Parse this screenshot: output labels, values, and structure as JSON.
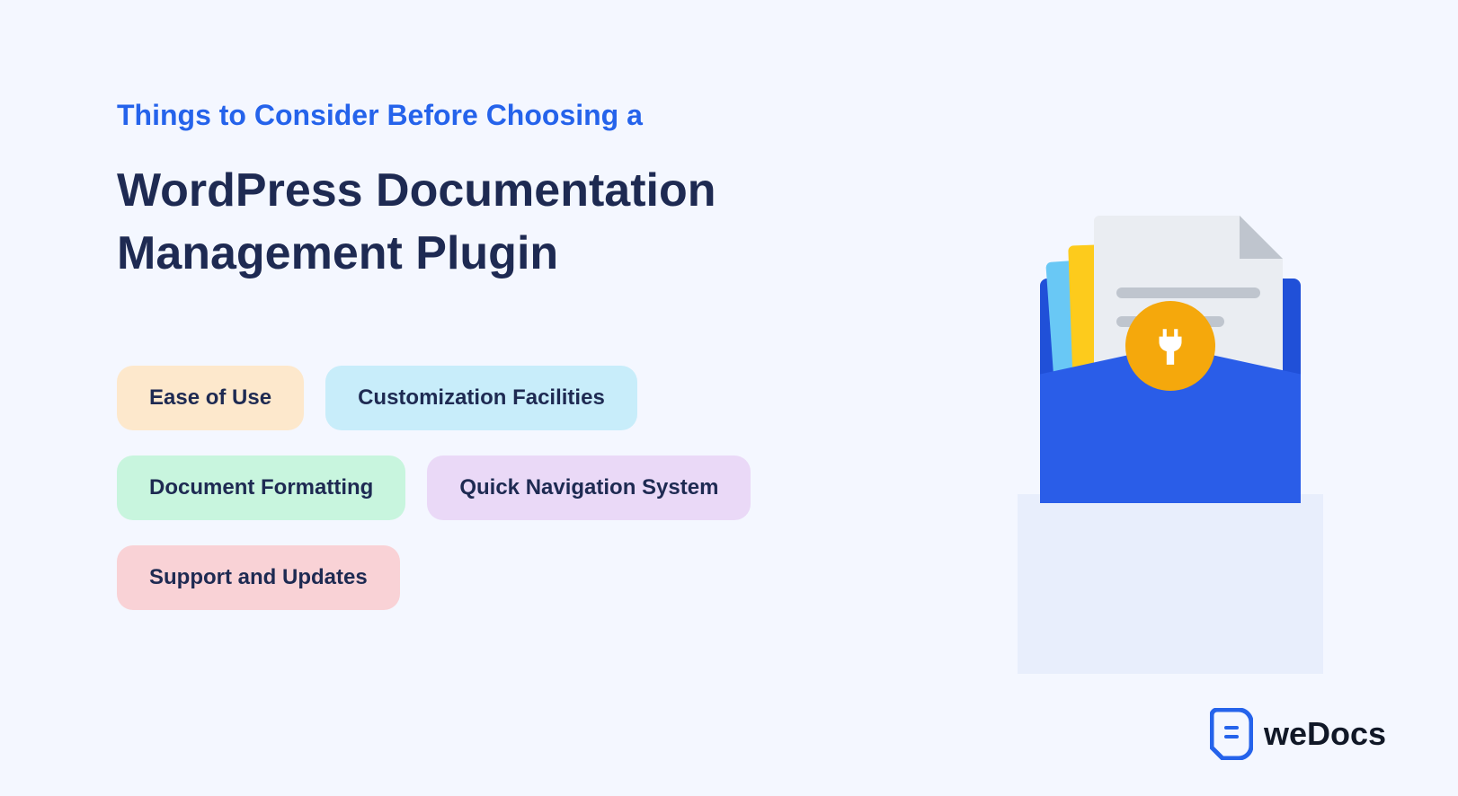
{
  "subtitle": "Things to Consider Before Choosing a",
  "title_line1": "WordPress Documentation",
  "title_line2": "Management Plugin",
  "pills": {
    "ease": "Ease of Use",
    "customization": "Customization Facilities",
    "formatting": "Document Formatting",
    "navigation": "Quick Navigation System",
    "support": "Support and Updates"
  },
  "brand": "weDocs"
}
